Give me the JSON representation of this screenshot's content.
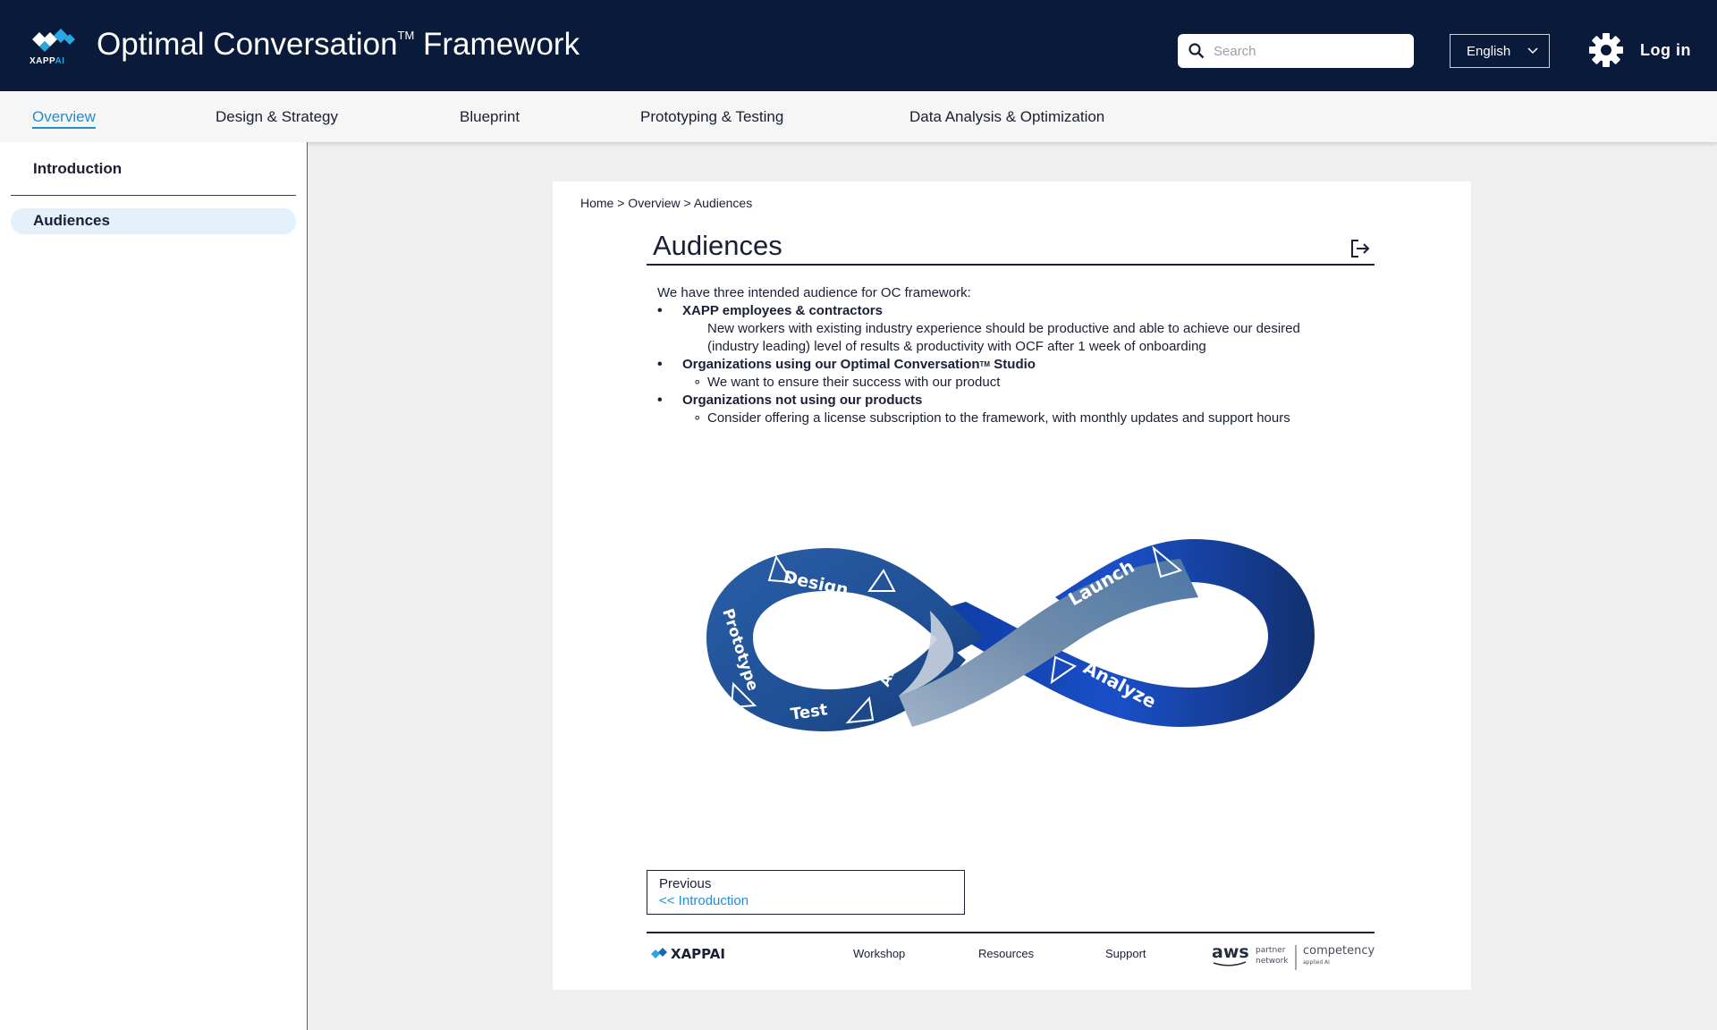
{
  "header": {
    "logo_text": "XAPP",
    "logo_text_ai": "AI",
    "title": "Optimal Conversation",
    "title_tm": "TM",
    "title_suffix": " Framework",
    "search_placeholder": "Search",
    "language": "English",
    "login": "Log in",
    "icons": [
      "search-icon",
      "chevron-down-icon",
      "gear-icon"
    ]
  },
  "nav": {
    "tabs": [
      {
        "label": "Overview",
        "active": true
      },
      {
        "label": "Design & Strategy"
      },
      {
        "label": "Blueprint"
      },
      {
        "label": "Prototyping & Testing"
      },
      {
        "label": "Data Analysis & Optimization"
      }
    ]
  },
  "sidebar": {
    "items": [
      {
        "label": "Introduction"
      },
      {
        "label": "Audiences",
        "active": true
      }
    ]
  },
  "main": {
    "breadcrumb": "Home > Overview > Audiences",
    "title": "Audiences",
    "intro": "We have three intended audience for OC framework:",
    "audiences": [
      {
        "name": "XAPP employees & contractors",
        "detail": "New workers with existing industry experience should be productive and able to achieve our desired (industry leading) level of results & productivity with OCF after 1 week of onboarding"
      },
      {
        "name": "Organizations using our Optimal Conversation",
        "name_tm": "TM",
        "name_suffix": " Studio",
        "detail": "We want to ensure their success with our product"
      },
      {
        "name": "Organizations not using our products",
        "detail": "Consider offering a license subscription to the framework, with monthly updates and support hours"
      }
    ],
    "infinity_labels": {
      "design": "Design",
      "prototype": "Prototype",
      "test": "Test",
      "analyze_left": "Analyze",
      "launch": "Launch",
      "analyze_right": "Analyze"
    },
    "previous": {
      "label": "Previous",
      "link": "<< Introduction"
    },
    "footer": {
      "logo": "XAPPAI",
      "links": [
        "Workshop",
        "Resources",
        "Support"
      ],
      "partner_aws": "aws",
      "partner_text1": "partner",
      "partner_text2": "network",
      "competency": "competency",
      "competency_sub": "applied AI"
    }
  },
  "colors": {
    "header_bg": "#0a1a3a",
    "accent": "#1f8ed6",
    "active_side_bg": "#e4f1fb"
  }
}
